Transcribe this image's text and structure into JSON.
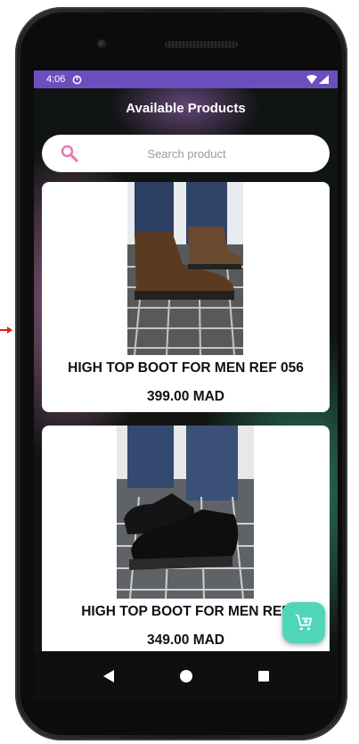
{
  "status_bar": {
    "time": "4:06"
  },
  "app_bar": {
    "title": "Available Products"
  },
  "search": {
    "placeholder": "Search product"
  },
  "products": [
    {
      "name": "HIGH TOP BOOT FOR MEN REF 056",
      "price": "399.00 MAD"
    },
    {
      "name": "HIGH TOP BOOT FOR MEN REF",
      "price": "349.00 MAD"
    }
  ],
  "icons": {
    "search": "search-icon",
    "cart": "add-to-cart-icon",
    "back": "back-triangle-icon",
    "home": "home-circle-icon",
    "recents": "recents-square-icon"
  },
  "colors": {
    "status_bar": "#6b4fbf",
    "fab": "#4fd6b8",
    "search_icon": "#e779b8"
  }
}
